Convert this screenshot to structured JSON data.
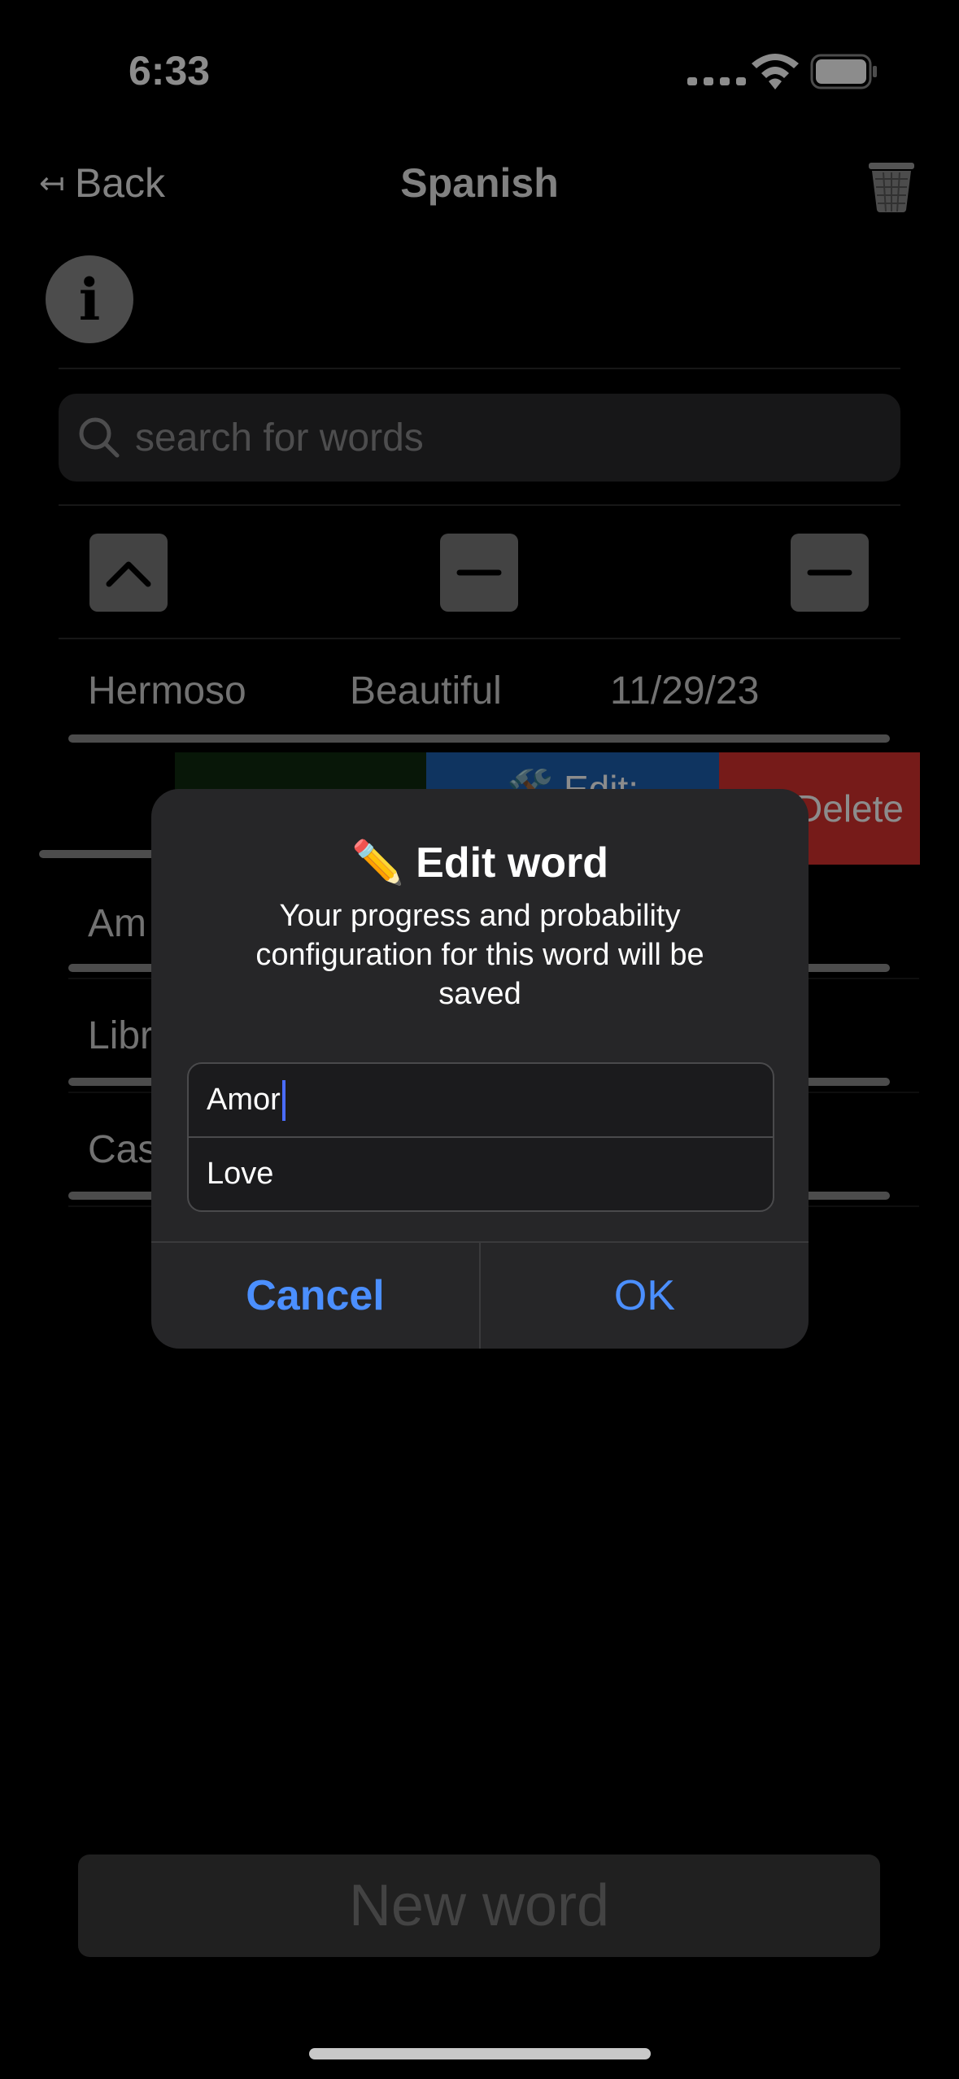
{
  "status_bar": {
    "time": "6:33"
  },
  "nav": {
    "back_label": "Back",
    "back_arrow": "↤",
    "title": "Spanish"
  },
  "info_glyph": "i",
  "search": {
    "placeholder": "search for words"
  },
  "rows": [
    {
      "word": "Hermoso",
      "translation": "Beautiful",
      "date": "11/29/23"
    },
    {
      "word": "Amor",
      "visible_fragment": "Am"
    },
    {
      "word": "Libro",
      "visible_fragment": "Libr"
    },
    {
      "word": "Casa",
      "visible_fragment": "Cas"
    }
  ],
  "swipe_actions": {
    "edit_label": "🛠️ Edit:",
    "delete_label": "Delete"
  },
  "alert": {
    "title": "✏️ Edit word",
    "message": "Your progress and probability configuration for this word will be saved",
    "field1_value": "Amor",
    "field2_value": "Love",
    "cancel_label": "Cancel",
    "ok_label": "OK"
  },
  "new_word_label": "New word",
  "colors": {
    "accent_blue": "#4b8fff",
    "delete_red": "#d8322f",
    "edit_blue": "#1c5fb0"
  }
}
